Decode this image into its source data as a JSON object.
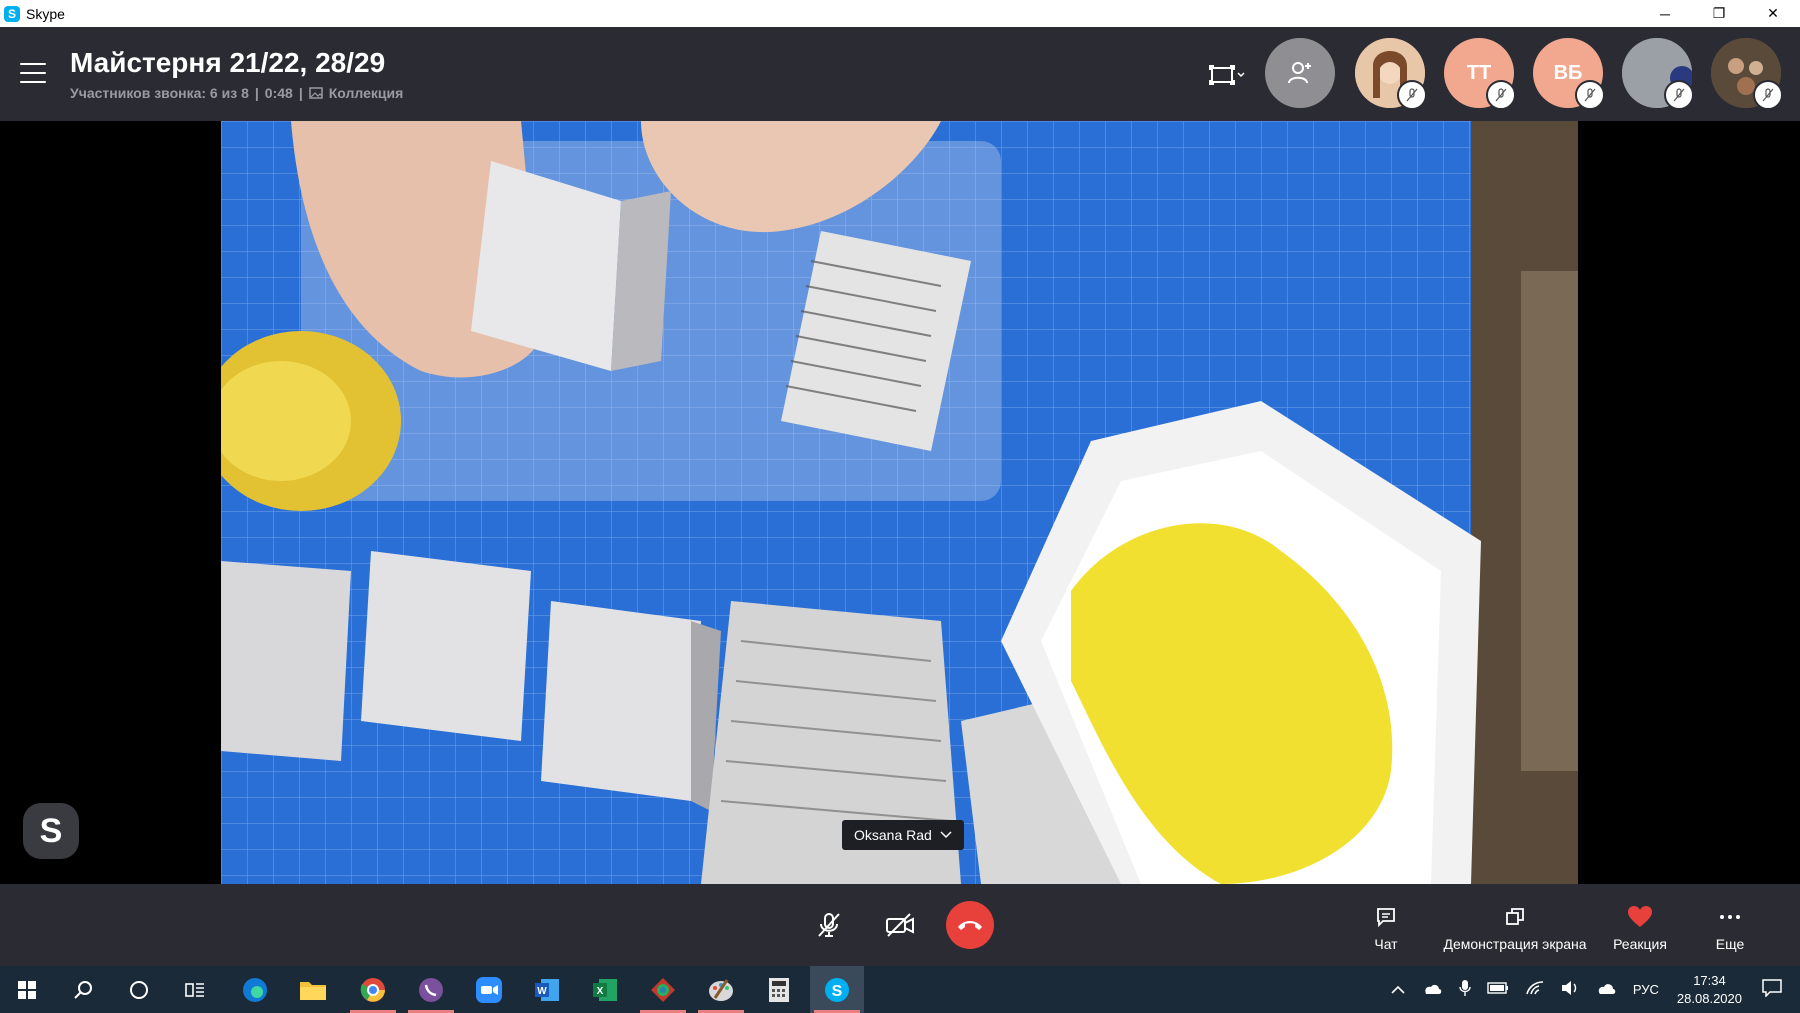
{
  "window": {
    "title": "Skype",
    "app_icon": "S",
    "controls": {
      "minimize": "─",
      "restore": "❐",
      "close": "✕"
    }
  },
  "header": {
    "title": "Майстерня 21/22, 28/29",
    "participants": "Участников звонка: 6 из 8",
    "duration": "0:48",
    "collection": "Коллекция",
    "avatars": [
      {
        "name": "participant-photo-1",
        "initials": "",
        "bg": "#c98b5e"
      },
      {
        "name": "participant-tt",
        "initials": "ТТ",
        "bg": "#f2a88f"
      },
      {
        "name": "participant-vb",
        "initials": "ВБ",
        "bg": "#f2a88f"
      },
      {
        "name": "participant-photo-2",
        "initials": "",
        "bg": "#8a8d92"
      },
      {
        "name": "participant-photo-3",
        "initials": "",
        "bg": "#6b5a4a"
      }
    ]
  },
  "video": {
    "speaker_name": "Oksana Rad",
    "bg": "#2a6fd6"
  },
  "floating": {
    "skype_letter": "S"
  },
  "controls": {
    "chat_label": "Чат",
    "share_label": "Демонстрация экрана",
    "reaction_label": "Реакция",
    "more_label": "Еще",
    "end_call_color": "#e8413c"
  },
  "taskbar": {
    "lang": "РУС",
    "time": "17:34",
    "date": "28.08.2020",
    "skype_letter": "S"
  }
}
